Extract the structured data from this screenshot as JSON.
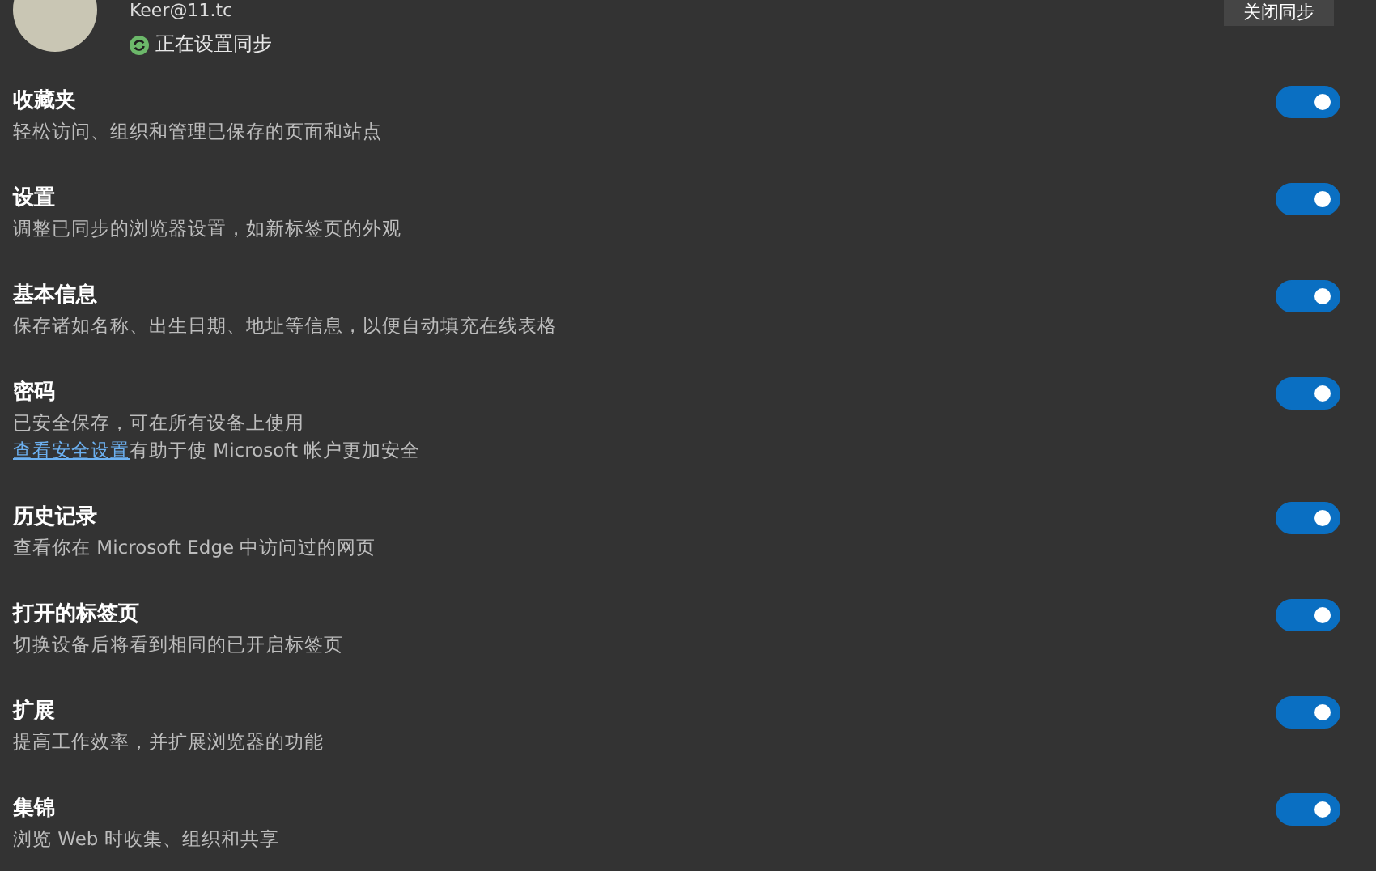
{
  "account": {
    "email": "Keer@11.tc",
    "status": "正在设置同步",
    "button": "关闭同步"
  },
  "items": [
    {
      "title": "收藏夹",
      "description": "轻松访问、组织和管理已保存的页面和站点",
      "on": true
    },
    {
      "title": "设置",
      "description": "调整已同步的浏览器设置，如新标签页的外观",
      "on": true
    },
    {
      "title": "基本信息",
      "description": "保存诸如名称、出生日期、地址等信息，以便自动填充在线表格",
      "on": true
    },
    {
      "title": "密码",
      "description": "已安全保存，可在所有设备上使用",
      "link": "查看安全设置",
      "link_note": "有助于使 Microsoft 帐户更加安全",
      "on": true
    },
    {
      "title": "历史记录",
      "description": "查看你在 Microsoft Edge 中访问过的网页",
      "on": true
    },
    {
      "title": "打开的标签页",
      "description": "切换设备后将看到相同的已开启标签页",
      "on": true
    },
    {
      "title": "扩展",
      "description": "提高工作效率，并扩展浏览器的功能",
      "on": true
    },
    {
      "title": "集锦",
      "description": "浏览 Web 时收集、组织和共享",
      "on": true
    }
  ]
}
